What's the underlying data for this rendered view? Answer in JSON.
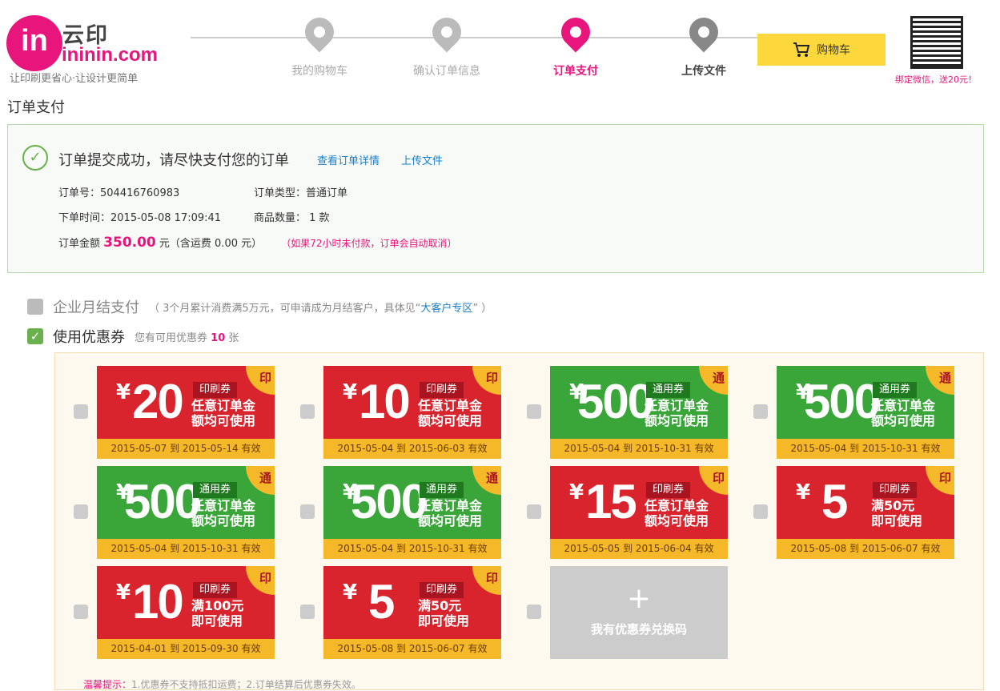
{
  "header": {
    "logo_glyph": "in",
    "brand_cn": "云印",
    "brand_en": "ininin.com",
    "tagline": "让印刷更省心·让设计更简单",
    "steps": [
      "我的购物车",
      "确认订单信息",
      "订单支付",
      "上传文件"
    ],
    "active_step": "订单支付",
    "cart_label": "购物车",
    "cart_icon": "cart-icon",
    "qr_caption": "绑定微信，送20元！"
  },
  "page": {
    "title": "订单支付"
  },
  "order": {
    "success_msg": "订单提交成功，请尽快支付您的订单",
    "link_detail": "查看订单详情",
    "link_upload": "上传文件",
    "order_no": "订单号：504416760983",
    "order_type": "订单类型：普通订单",
    "order_time": "下单时间：2015-05-08 17:09:41",
    "item_count": "商品数量： 1 款",
    "amount_label": "订单金额",
    "amount": "350.00",
    "amount_suffix": "元（含运费 0.00 元）",
    "cancel_note": "（如果72小时未付款，订单会自动取消）"
  },
  "options": {
    "monthly_label": "企业月结支付",
    "monthly_note_pre": "（ 3个月累计消费满5万元，可申请成为月结客户，具体见“",
    "monthly_link": "大客户专区",
    "monthly_note_post": "” ）",
    "coupon_label": "使用优惠券",
    "coupon_note_pre": "您有可用优惠券",
    "coupon_count": "10",
    "coupon_note_post": "张"
  },
  "colors": {
    "brand": "#e8157d",
    "red": "#d9242e",
    "green": "#3aa63a",
    "gold": "#f4b829"
  },
  "coupons": [
    {
      "yen": "¥",
      "amount": "20",
      "type": "印刷券",
      "corner": "印",
      "desc1": "任意订单金",
      "desc2": "额均可使用",
      "valid": "2015-05-07 到 2015-05-14 有效",
      "color": "red"
    },
    {
      "yen": "¥",
      "amount": "10",
      "type": "印刷券",
      "corner": "印",
      "desc1": "任意订单金",
      "desc2": "额均可使用",
      "valid": "2015-05-04 到 2015-06-03 有效",
      "color": "red"
    },
    {
      "yen": "¥",
      "amount": "500",
      "type": "通用券",
      "corner": "通",
      "desc1": "任意订单金",
      "desc2": "额均可使用",
      "valid": "2015-05-04 到 2015-10-31 有效",
      "color": "green"
    },
    {
      "yen": "¥",
      "amount": "500",
      "type": "通用券",
      "corner": "通",
      "desc1": "任意订单金",
      "desc2": "额均可使用",
      "valid": "2015-05-04 到 2015-10-31 有效",
      "color": "green"
    },
    {
      "yen": "¥",
      "amount": "500",
      "type": "通用券",
      "corner": "通",
      "desc1": "任意订单金",
      "desc2": "额均可使用",
      "valid": "2015-05-04 到 2015-10-31 有效",
      "color": "green"
    },
    {
      "yen": "¥",
      "amount": "500",
      "type": "通用券",
      "corner": "通",
      "desc1": "任意订单金",
      "desc2": "额均可使用",
      "valid": "2015-05-04 到 2015-10-31 有效",
      "color": "green"
    },
    {
      "yen": "¥",
      "amount": "15",
      "type": "印刷券",
      "corner": "印",
      "desc1": "任意订单金",
      "desc2": "额均可使用",
      "valid": "2015-05-05 到 2015-06-04 有效",
      "color": "red"
    },
    {
      "yen": "¥",
      "amount": "5",
      "type": "印刷券",
      "corner": "印",
      "desc1": "满50元",
      "desc2": "即可使用",
      "valid": "2015-05-08 到 2015-06-07 有效",
      "color": "red"
    },
    {
      "yen": "¥",
      "amount": "10",
      "type": "印刷券",
      "corner": "印",
      "desc1": "满100元",
      "desc2": "即可使用",
      "valid": "2015-04-01 到 2015-09-30 有效",
      "color": "red"
    },
    {
      "yen": "¥",
      "amount": "5",
      "type": "印刷券",
      "corner": "印",
      "desc1": "满50元",
      "desc2": "即可使用",
      "valid": "2015-05-08 到 2015-06-07 有效",
      "color": "red"
    }
  ],
  "redeem": {
    "plus": "+",
    "label": "我有优惠券兑换码"
  },
  "tip": {
    "label": "温馨提示：",
    "text": "1.优惠券不支持抵扣运费；2.订单结算后优惠券失效。"
  }
}
